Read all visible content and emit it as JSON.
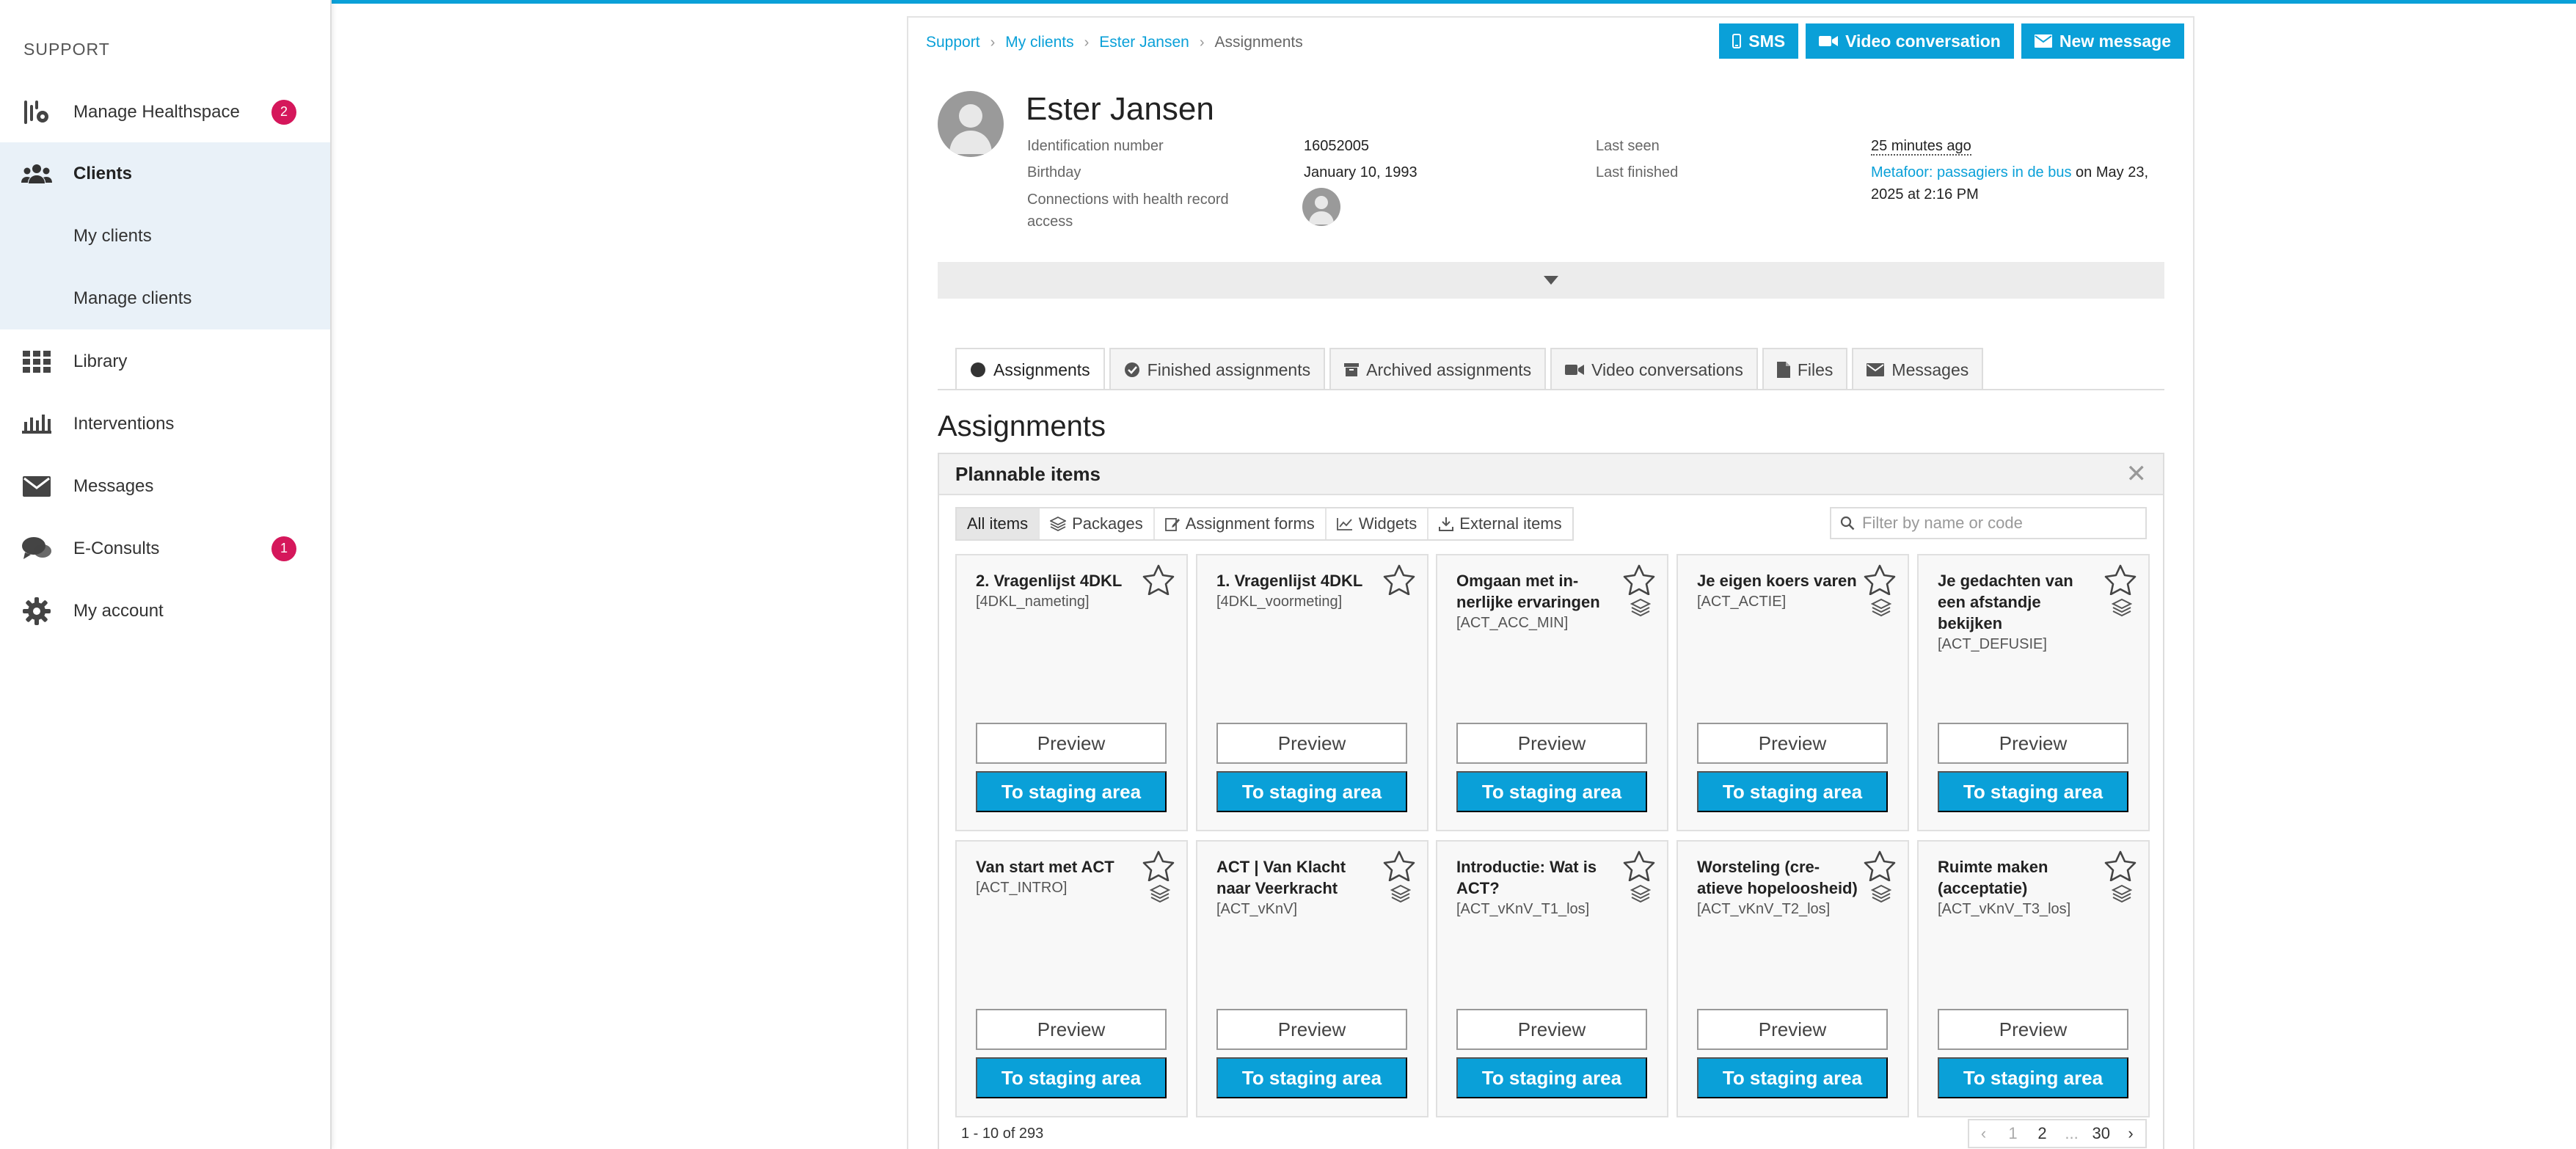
{
  "sidebar": {
    "heading": "SUPPORT",
    "items": [
      {
        "label": "Manage Healthspace",
        "icon": "healthspace-icon",
        "badge": "2"
      },
      {
        "label": "Clients",
        "icon": "users-icon"
      },
      {
        "label": "My clients"
      },
      {
        "label": "Manage clients"
      },
      {
        "label": "Library",
        "icon": "grid-icon"
      },
      {
        "label": "Interventions",
        "icon": "interventions-icon"
      },
      {
        "label": "Messages",
        "icon": "envelope-icon"
      },
      {
        "label": "E-Consults",
        "icon": "chat-icon",
        "badge": "1"
      },
      {
        "label": "My account",
        "icon": "gear-icon"
      }
    ]
  },
  "breadcrumb": [
    "Support",
    "My clients",
    "Ester Jansen",
    "Assignments"
  ],
  "actions": {
    "sms": "SMS",
    "video": "Video conversation",
    "message": "New message"
  },
  "client": {
    "name": "Ester Jansen",
    "id_label": "Identification number",
    "id_value": "16052005",
    "birthday_label": "Birthday",
    "birthday_value": "January 10, 1993",
    "connections_label": "Connections with health record access",
    "last_seen_label": "Last seen",
    "last_seen_value": "25 minutes ago",
    "last_finished_label": "Last finished",
    "last_finished_link": "Metafoor: passagiers in de bus",
    "last_finished_rest": " on May 23, 2025 at 2:16 PM"
  },
  "tabs": [
    {
      "label": "Assignments",
      "icon": "circle-icon"
    },
    {
      "label": "Finished assignments",
      "icon": "check-circle-icon"
    },
    {
      "label": "Archived assignments",
      "icon": "archive-icon"
    },
    {
      "label": "Video conversations",
      "icon": "video-icon"
    },
    {
      "label": "Files",
      "icon": "file-icon"
    },
    {
      "label": "Messages",
      "icon": "envelope-icon"
    }
  ],
  "section_title": "Assignments",
  "plannable": {
    "title": "Plannable items",
    "filters": [
      "All items",
      "Packages",
      "Assignment forms",
      "Widgets",
      "External items"
    ],
    "filter_placeholder": "Filter by name or code",
    "preview_label": "Preview",
    "stage_label": "To staging area",
    "cards": [
      {
        "title": "2. Vragenlijst 4DKL",
        "code": "[4DKL_nameting]",
        "stack": false
      },
      {
        "title": "1. Vragenlijst 4DKL",
        "code": "[4DKL_voormeting]",
        "stack": false
      },
      {
        "title": "Omgaan met in­nerlijke ervaringen",
        "code": "[ACT_ACC_MIN]",
        "stack": true
      },
      {
        "title": "Je eigen koers varen",
        "code": "[ACT_ACTIE]",
        "stack": true
      },
      {
        "title": "Je gedachten van een afstand­je bekijken",
        "code": "[ACT_DEFUSIE]",
        "stack": true
      },
      {
        "title": "Van start met ACT",
        "code": "[ACT_INTRO]",
        "stack": true
      },
      {
        "title": "ACT | Van Klacht naar Veerkracht",
        "code": "[ACT_vKnV]",
        "stack": true
      },
      {
        "title": "Introductie: Wat is ACT?",
        "code": "[ACT_vKnV_T1_los]",
        "stack": true
      },
      {
        "title": "Worsteling (cre­atieve hopeloosheid)",
        "code": "[ACT_vKnV_T2_los]",
        "stack": true
      },
      {
        "title": "Ruimte maken (acceptatie)",
        "code": "[ACT_vKnV_T3_los]",
        "stack": true
      }
    ],
    "count_text": "1 - 10 of 293",
    "pager": [
      "1",
      "2",
      "...",
      "30"
    ]
  }
}
